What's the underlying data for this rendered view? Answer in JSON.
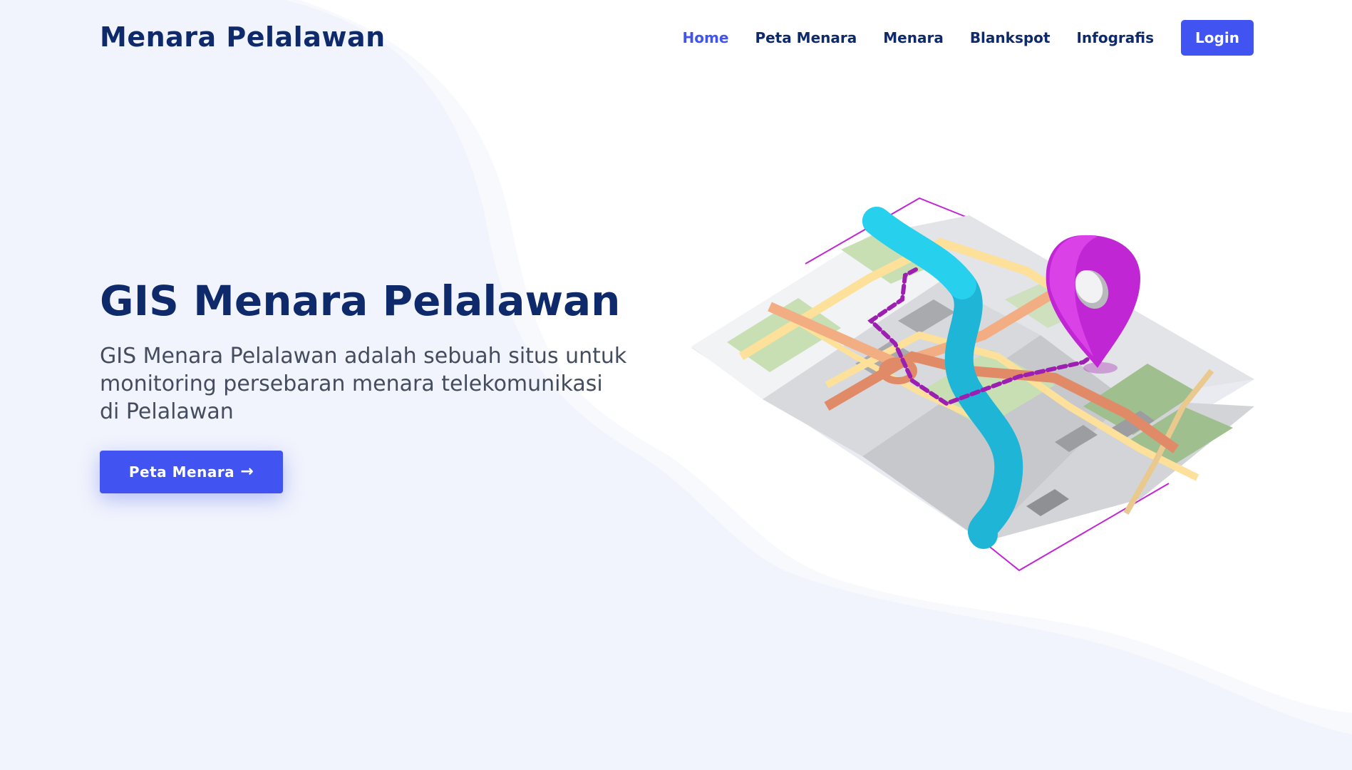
{
  "navbar": {
    "brand": "Menara Pelalawan",
    "links": [
      {
        "label": "Home",
        "active": true
      },
      {
        "label": "Peta Menara",
        "active": false
      },
      {
        "label": "Menara",
        "active": false
      },
      {
        "label": "Blankspot",
        "active": false
      },
      {
        "label": "Infografis",
        "active": false
      }
    ],
    "login_label": "Login"
  },
  "hero": {
    "title": "GIS Menara Pelalawan",
    "description": "GIS Menara Pelalawan adalah sebuah situs untuk monitoring persebaran menara telekomunikasi di Pelalawan",
    "cta_label": "Peta Menara",
    "cta_icon": "arrow-right-icon",
    "illustration_icon": "map-location-pin-icon"
  },
  "colors": {
    "accent": "#4154f1",
    "heading": "#0f2a6b",
    "body_text": "#444c5e",
    "background_tint": "#f1f4fc",
    "pin": "#c026d3"
  }
}
